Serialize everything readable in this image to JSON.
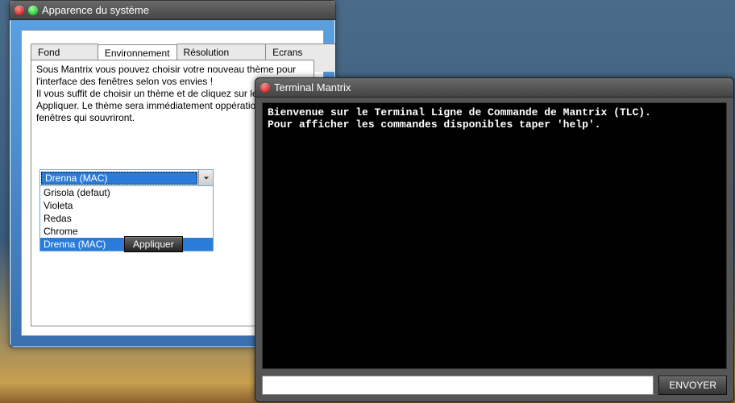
{
  "appearance": {
    "title": "Apparence du système",
    "tabs": [
      {
        "label": "Fond d'écran",
        "active": false
      },
      {
        "label": "Environnement",
        "active": true
      },
      {
        "label": "Résolution d'écran",
        "active": false
      },
      {
        "label": "Ecrans veilles",
        "active": false
      }
    ],
    "description_lines": [
      "Sous Mantrix vous pouvez choisir votre nouveau thème pour l'interface des fenêtres selon vos envies !",
      "Il vous suffit de choisir un thème et de cliquez sur le bouton Appliquer. Le thème sera immédiatement oppérationnel sur les fenêtres qui souvriront."
    ],
    "theme_combo": {
      "selected": "Drenna (MAC)",
      "options": [
        {
          "label": "Grisola (defaut)",
          "highlight": false
        },
        {
          "label": "Violeta",
          "highlight": false
        },
        {
          "label": "Redas",
          "highlight": false
        },
        {
          "label": "Chrome",
          "highlight": false
        },
        {
          "label": "Drenna (MAC)",
          "highlight": true
        }
      ]
    },
    "apply_label": "Appliquer"
  },
  "terminal": {
    "title": "Terminal Mantrix",
    "output_lines": [
      "Bienvenue sur le Terminal Ligne de Commande de Mantrix (TLC).",
      "Pour afficher les commandes disponibles taper 'help'."
    ],
    "input_value": "",
    "send_label": "ENVOYER"
  },
  "icons": {
    "close": "close-icon",
    "minimize": "minimize-icon",
    "dropdown": "chevron-down-icon"
  }
}
